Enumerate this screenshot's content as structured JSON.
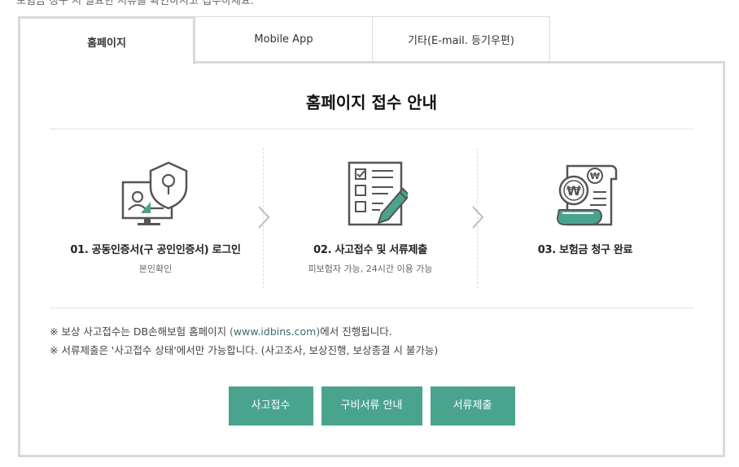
{
  "top_cut_text": "보험금 청구 시 필요한 서류를 확인하시고 접수하세요.",
  "tabs": [
    {
      "label": "홈페이지",
      "active": true
    },
    {
      "label": "Mobile App",
      "active": false
    },
    {
      "label": "기타(E-mail. 등기우편)",
      "active": false
    }
  ],
  "panel": {
    "title": "홈페이지 접수 안내"
  },
  "steps": [
    {
      "title": "01. 공동인증서(구 공인인증서) 로그인",
      "subtitle": "본인확인",
      "icon": "certificate-monitor-icon"
    },
    {
      "title": "02. 사고접수 및 서류제출",
      "subtitle": "피보험자 가능, 24시간 이용 가능",
      "icon": "checklist-pen-icon"
    },
    {
      "title": "03. 보험금 청구 완료",
      "subtitle": "",
      "icon": "won-receipt-icon"
    }
  ],
  "notes": {
    "line1_prefix": "※ 보상 사고접수는 DB손해보험 홈페이지 ",
    "line1_link": "(www.idbins.com)",
    "line1_suffix": "에서 진행됩니다.",
    "line2": "※ 서류제출은 '사고접수 상태'에서만 가능합니다. (사고조사, 보상진행, 보상종결 시 불가능)"
  },
  "buttons": {
    "accident": "사고접수",
    "documents_guide": "구비서류 안내",
    "submit_documents": "서류제출"
  },
  "colors": {
    "accent": "#4aa48d",
    "icon_stroke": "#555555",
    "link": "#3a6f6a"
  }
}
